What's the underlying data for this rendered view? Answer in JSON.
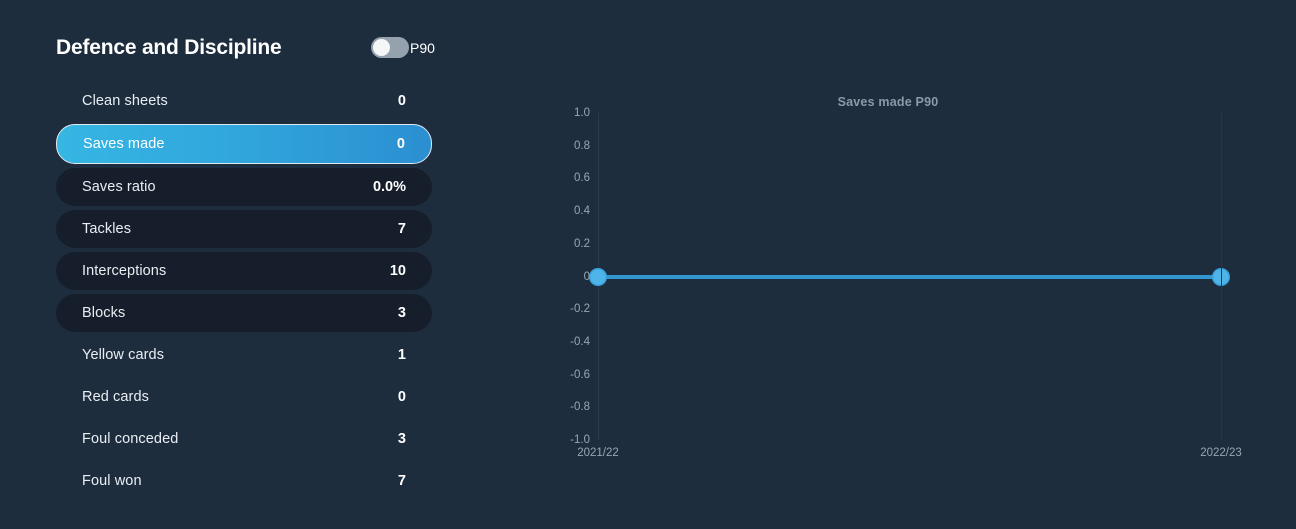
{
  "panel": {
    "title": "Defence and Discipline",
    "toggle": {
      "label": "P90",
      "state": "off"
    },
    "stats": [
      {
        "label": "Clean sheets",
        "value": "0",
        "style": "plain",
        "selected": false
      },
      {
        "label": "Saves made",
        "value": "0",
        "style": "selected",
        "selected": true
      },
      {
        "label": "Saves ratio",
        "value": "0.0%",
        "style": "pill",
        "selected": false
      },
      {
        "label": "Tackles",
        "value": "7",
        "style": "pill",
        "selected": false
      },
      {
        "label": "Interceptions",
        "value": "10",
        "style": "pill",
        "selected": false
      },
      {
        "label": "Blocks",
        "value": "3",
        "style": "pill",
        "selected": false
      },
      {
        "label": "Yellow cards",
        "value": "1",
        "style": "plain",
        "selected": false
      },
      {
        "label": "Red cards",
        "value": "0",
        "style": "plain",
        "selected": false
      },
      {
        "label": "Foul conceded",
        "value": "3",
        "style": "plain",
        "selected": false
      },
      {
        "label": "Foul won",
        "value": "7",
        "style": "plain",
        "selected": false
      }
    ]
  },
  "colors": {
    "page_background": "#1e2d3d",
    "pill_background": "#161e2b",
    "accent_line": "#3396cf",
    "accent_marker": "#4fb4e8",
    "selected_gradient_start": "#35b6e3",
    "selected_gradient_end": "#2b8fd0",
    "toggle_track": "#95a1ad",
    "toggle_knob": "#f4f6f8",
    "axis_text": "#97a6b4",
    "title_text": "#8a9aa9"
  },
  "chart_data": {
    "type": "line",
    "title": "Saves made P90",
    "xlabel": "",
    "ylabel": "",
    "categories": [
      "2021/22",
      "2022/23"
    ],
    "x": [
      "2021/22",
      "2022/23"
    ],
    "series": [
      {
        "name": "Saves made P90",
        "values": [
          0,
          0
        ]
      }
    ],
    "values": [
      0,
      0
    ],
    "ylim": [
      -1.0,
      1.0
    ],
    "yticks": [
      "1.0",
      "0.8",
      "0.6",
      "0.4",
      "0.2",
      "0",
      "-0.2",
      "-0.4",
      "-0.6",
      "-0.8",
      "-1.0"
    ],
    "ytick_values": [
      1.0,
      0.8,
      0.6,
      0.4,
      0.2,
      0,
      -0.2,
      -0.4,
      -0.6,
      -0.8,
      -1.0
    ],
    "xticks": [
      "2021/22",
      "2022/23"
    ],
    "grid": false,
    "legend": "none",
    "markers": true
  }
}
